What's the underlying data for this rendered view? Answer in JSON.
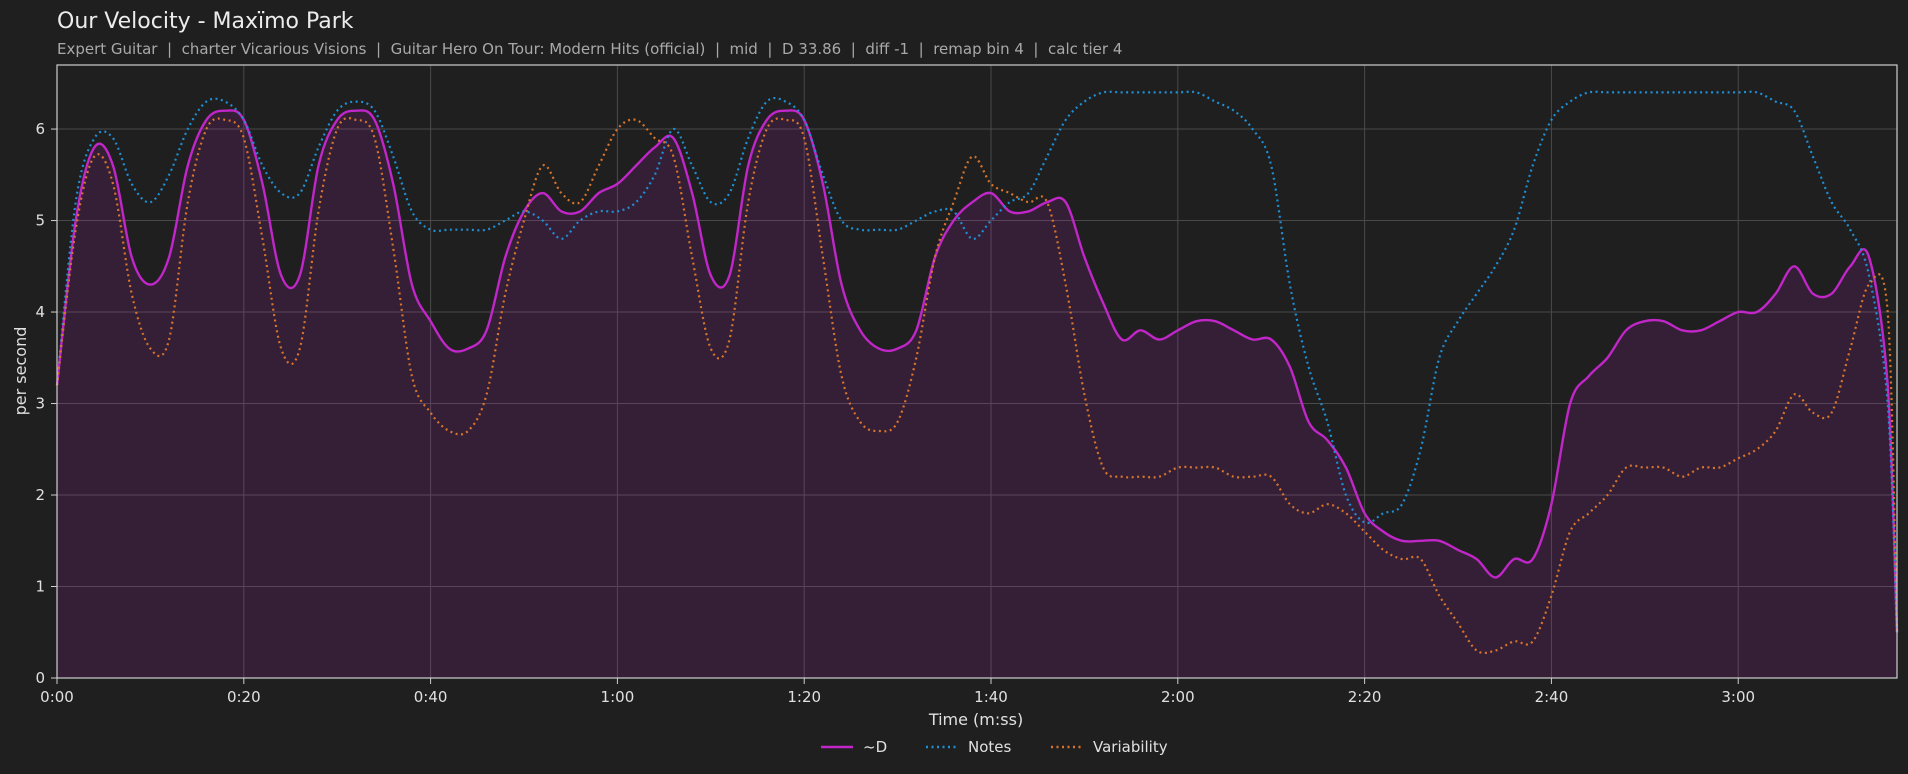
{
  "chart_data": {
    "type": "line",
    "title": "Our Velocity - Maxïmo Park",
    "subtitle": "Expert Guitar  |  charter Vicarious Visions  |  Guitar Hero On Tour: Modern Hits (official)  |  mid  |  D 33.86  |  diff -1  |  remap bin 4  |  calc tier 4",
    "xlabel": "Time (m:ss)",
    "ylabel": "per second",
    "xlim": [
      0,
      197
    ],
    "ylim": [
      0,
      6.7
    ],
    "x_ticks": [
      0,
      20,
      40,
      60,
      80,
      100,
      120,
      140,
      160,
      180
    ],
    "x_tick_labels": [
      "0:00",
      "0:20",
      "0:40",
      "1:00",
      "1:20",
      "1:40",
      "2:00",
      "2:20",
      "2:40",
      "3:00"
    ],
    "y_ticks": [
      0,
      1,
      2,
      3,
      4,
      5,
      6
    ],
    "y_tick_labels": [
      "0",
      "1",
      "2",
      "3",
      "4",
      "5",
      "6"
    ],
    "grid": true,
    "legend_position": "bottom-center",
    "x": [
      0,
      2,
      4,
      6,
      8,
      10,
      12,
      14,
      16,
      18,
      20,
      22,
      24,
      26,
      28,
      30,
      32,
      34,
      36,
      38,
      40,
      42,
      44,
      46,
      48,
      50,
      52,
      54,
      56,
      58,
      60,
      62,
      64,
      66,
      68,
      70,
      72,
      74,
      76,
      78,
      80,
      82,
      84,
      86,
      88,
      90,
      92,
      94,
      96,
      98,
      100,
      102,
      104,
      106,
      108,
      110,
      112,
      114,
      116,
      118,
      120,
      122,
      124,
      126,
      128,
      130,
      132,
      134,
      136,
      138,
      140,
      142,
      144,
      146,
      148,
      150,
      152,
      154,
      156,
      158,
      160,
      162,
      164,
      166,
      168,
      170,
      172,
      174,
      176,
      178,
      180,
      182,
      184,
      186,
      188,
      190,
      192,
      194,
      196,
      197
    ],
    "series": [
      {
        "name": "~D",
        "color": "#c026c8",
        "style": "solid",
        "filled": true,
        "values": [
          3.2,
          5.0,
          5.8,
          5.6,
          4.6,
          4.3,
          4.6,
          5.6,
          6.1,
          6.2,
          6.1,
          5.4,
          4.4,
          4.4,
          5.6,
          6.1,
          6.2,
          6.1,
          5.4,
          4.3,
          3.9,
          3.6,
          3.6,
          3.8,
          4.6,
          5.1,
          5.3,
          5.1,
          5.1,
          5.3,
          5.4,
          5.6,
          5.8,
          5.9,
          5.3,
          4.4,
          4.4,
          5.6,
          6.1,
          6.2,
          6.1,
          5.4,
          4.3,
          3.8,
          3.6,
          3.6,
          3.8,
          4.6,
          5.0,
          5.2,
          5.3,
          5.1,
          5.1,
          5.2,
          5.2,
          4.6,
          4.1,
          3.7,
          3.8,
          3.7,
          3.8,
          3.9,
          3.9,
          3.8,
          3.7,
          3.7,
          3.4,
          2.8,
          2.6,
          2.3,
          1.8,
          1.6,
          1.5,
          1.5,
          1.5,
          1.4,
          1.3,
          1.1,
          1.3,
          1.3,
          1.9,
          3.0,
          3.3,
          3.5,
          3.8,
          3.9,
          3.9,
          3.8,
          3.8,
          3.9,
          4.0,
          4.0,
          4.2,
          4.5,
          4.2,
          4.2,
          4.5,
          4.6,
          3.2,
          0.5
        ]
      },
      {
        "name": "Notes",
        "color": "#1f8fd6",
        "style": "dotted",
        "filled": false,
        "values": [
          3.2,
          5.2,
          5.9,
          5.9,
          5.4,
          5.2,
          5.5,
          6.0,
          6.3,
          6.3,
          6.1,
          5.6,
          5.3,
          5.3,
          5.8,
          6.2,
          6.3,
          6.2,
          5.7,
          5.1,
          4.9,
          4.9,
          4.9,
          4.9,
          5.0,
          5.1,
          5.0,
          4.8,
          5.0,
          5.1,
          5.1,
          5.2,
          5.5,
          6.0,
          5.6,
          5.2,
          5.3,
          5.9,
          6.3,
          6.3,
          6.1,
          5.5,
          5.0,
          4.9,
          4.9,
          4.9,
          5.0,
          5.1,
          5.1,
          4.8,
          5.0,
          5.2,
          5.3,
          5.7,
          6.1,
          6.3,
          6.4,
          6.4,
          6.4,
          6.4,
          6.4,
          6.4,
          6.3,
          6.2,
          6.0,
          5.6,
          4.3,
          3.4,
          2.8,
          2.0,
          1.7,
          1.8,
          1.9,
          2.5,
          3.5,
          3.9,
          4.2,
          4.5,
          4.9,
          5.6,
          6.1,
          6.3,
          6.4,
          6.4,
          6.4,
          6.4,
          6.4,
          6.4,
          6.4,
          6.4,
          6.4,
          6.4,
          6.3,
          6.2,
          5.7,
          5.2,
          4.9,
          4.4,
          3.0,
          0.5
        ]
      },
      {
        "name": "Variability",
        "color": "#d8742b",
        "style": "dotted",
        "filled": false,
        "values": [
          3.2,
          4.9,
          5.7,
          5.4,
          4.2,
          3.6,
          3.7,
          5.2,
          6.0,
          6.1,
          5.9,
          4.8,
          3.6,
          3.6,
          5.1,
          6.0,
          6.1,
          5.9,
          4.7,
          3.3,
          2.9,
          2.7,
          2.7,
          3.1,
          4.2,
          5.0,
          5.6,
          5.3,
          5.2,
          5.6,
          6.0,
          6.1,
          5.9,
          5.7,
          4.6,
          3.6,
          3.7,
          5.2,
          6.0,
          6.1,
          5.9,
          4.6,
          3.3,
          2.8,
          2.7,
          2.8,
          3.5,
          4.6,
          5.2,
          5.7,
          5.4,
          5.3,
          5.2,
          5.2,
          4.3,
          3.1,
          2.3,
          2.2,
          2.2,
          2.2,
          2.3,
          2.3,
          2.3,
          2.2,
          2.2,
          2.2,
          1.9,
          1.8,
          1.9,
          1.8,
          1.6,
          1.4,
          1.3,
          1.3,
          0.9,
          0.6,
          0.3,
          0.3,
          0.4,
          0.4,
          0.9,
          1.6,
          1.8,
          2.0,
          2.3,
          2.3,
          2.3,
          2.2,
          2.3,
          2.3,
          2.4,
          2.5,
          2.7,
          3.1,
          2.9,
          2.9,
          3.6,
          4.3,
          4.0,
          0.5
        ]
      }
    ],
    "background_color": "#1f1f1f",
    "grid_color": "#4a4a4a",
    "axis_color": "#cfcfcf"
  }
}
